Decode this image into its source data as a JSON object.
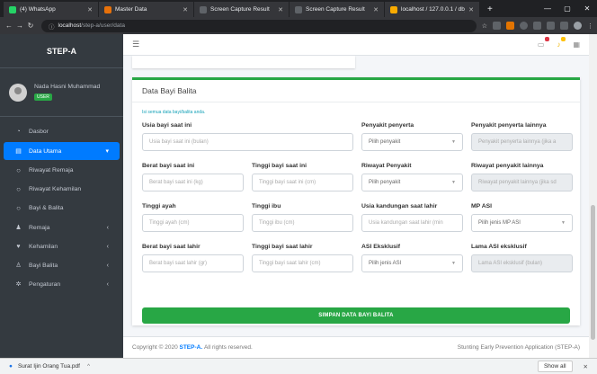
{
  "browser": {
    "tabs": [
      {
        "label": "(4) WhatsApp",
        "color": "#25d366"
      },
      {
        "label": "Master Data",
        "color": "#e8710a"
      },
      {
        "label": "Screen Capture Result",
        "color": "#5f6368"
      },
      {
        "label": "Screen Capture Result",
        "color": "#5f6368"
      },
      {
        "label": "localhost / 127.0.0.1 / db_step",
        "color": "#f9ab00"
      }
    ],
    "new_tab": "+",
    "url_host": "localhost",
    "url_path": "/step-a/user/data"
  },
  "sidebar": {
    "brand": "STEP-A",
    "user_name": "Nada Hasni Muhammad",
    "user_role": "USER",
    "items": [
      {
        "label": "Dasbor",
        "icon": "◔",
        "arrow": "",
        "sub": false,
        "active": false
      },
      {
        "label": "Data Utama",
        "icon": "▤",
        "arrow": "▾",
        "sub": false,
        "active": true
      },
      {
        "label": "Riwayat Remaja",
        "icon": "○",
        "arrow": "",
        "sub": true,
        "active": false
      },
      {
        "label": "Riwayat Kehamilan",
        "icon": "○",
        "arrow": "",
        "sub": true,
        "active": false
      },
      {
        "label": "Bayi & Balita",
        "icon": "○",
        "arrow": "",
        "sub": true,
        "active": false
      },
      {
        "label": "Remaja",
        "icon": "♟",
        "arrow": "‹",
        "sub": false,
        "active": false
      },
      {
        "label": "Kehamilan",
        "icon": "♥",
        "arrow": "‹",
        "sub": false,
        "active": false
      },
      {
        "label": "Bayi Balita",
        "icon": "♙",
        "arrow": "‹",
        "sub": false,
        "active": false
      },
      {
        "label": "Pengaturan",
        "icon": "✲",
        "arrow": "‹",
        "sub": false,
        "active": false
      }
    ]
  },
  "card": {
    "title": "Data Bayi Balita",
    "hint": "Isi semua data bayi/balita anda.",
    "save_label": "SIMPAN DATA BAYI BALITA"
  },
  "fields": [
    {
      "label": "Usia bayi saat ini",
      "placeholder": "Usia bayi saat ini (bulan)",
      "kind": "input",
      "wide": true
    },
    {
      "label": "Penyakit penyerta",
      "placeholder": "Pilih penyakit",
      "kind": "select",
      "wide": false
    },
    {
      "label": "Penyakit penyerta lainnya",
      "placeholder": "Penyakit penyerta lainnya (jika a",
      "kind": "disabled",
      "wide": false
    },
    {
      "label": "Berat bayi saat ini",
      "placeholder": "Berat bayi saat ini (kg)",
      "kind": "input",
      "wide": false
    },
    {
      "label": "Tinggi bayi saat ini",
      "placeholder": "Tinggi bayi saat ini (cm)",
      "kind": "input",
      "wide": false
    },
    {
      "label": "Riwayat Penyakit",
      "placeholder": "Pilih penyakit",
      "kind": "select",
      "wide": false
    },
    {
      "label": "Riwayat penyakit lainnya",
      "placeholder": "Riwayat penyakit lainnya (jika sd",
      "kind": "disabled",
      "wide": false
    },
    {
      "label": "Tinggi ayah",
      "placeholder": "Tinggi ayah (cm)",
      "kind": "input",
      "wide": false
    },
    {
      "label": "Tinggi ibu",
      "placeholder": "Tinggi ibu (cm)",
      "kind": "input",
      "wide": false
    },
    {
      "label": "Usia kandungan saat lahir",
      "placeholder": "Usia kandungan saat lahir (min",
      "kind": "input",
      "wide": false
    },
    {
      "label": "MP ASI",
      "placeholder": "Pilih jenis MP ASI",
      "kind": "select",
      "wide": false
    },
    {
      "label": "Berat bayi saat lahir",
      "placeholder": "Berat bayi saat lahir (gr)",
      "kind": "input",
      "wide": false
    },
    {
      "label": "Tinggi bayi saat lahir",
      "placeholder": "Tinggi bayi saat lahir (cm)",
      "kind": "input",
      "wide": false
    },
    {
      "label": "ASI Eksklusif",
      "placeholder": "Pilih jenis ASI",
      "kind": "select",
      "wide": false
    },
    {
      "label": "Lama ASI eksklusif",
      "placeholder": "Lama ASI eksklusif (bulan)",
      "kind": "disabled",
      "wide": false
    }
  ],
  "footer": {
    "copyright_prefix": "Copyright © 2020",
    "brand": "STEP-A.",
    "suffix": "All rights reserved.",
    "right": "Stunting Early Prevention Application (STEP-A)"
  },
  "downloads": {
    "file": "Surat Ijin Orang Tua.pdf",
    "show_all": "Show all"
  },
  "colors": {
    "accent": "#007bff",
    "success": "#28a745",
    "sidebar": "#343a40"
  }
}
